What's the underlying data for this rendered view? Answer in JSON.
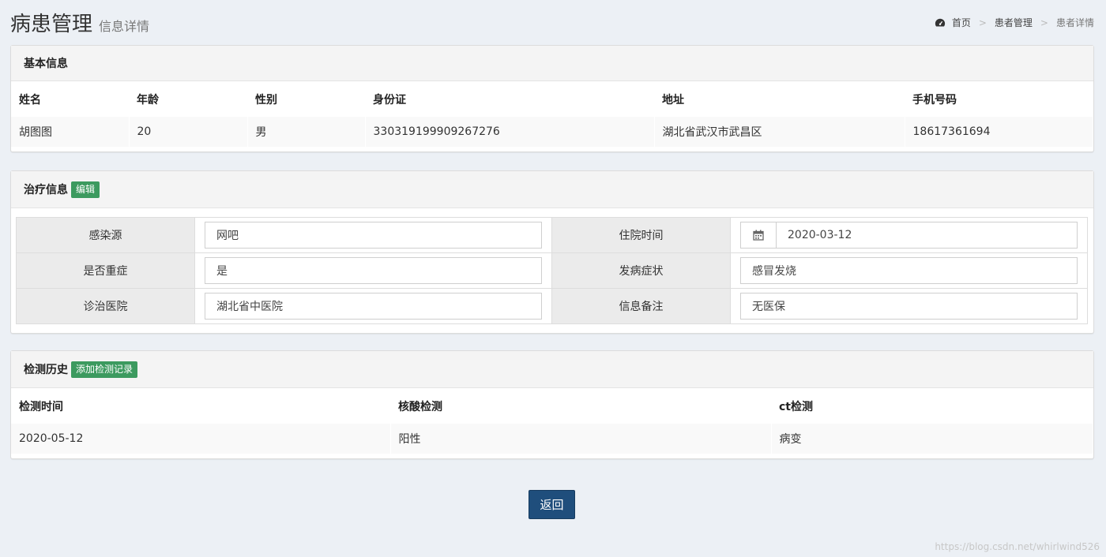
{
  "header": {
    "title": "病患管理",
    "subtitle": "信息详情",
    "breadcrumb": {
      "home": "首页",
      "section": "患者管理",
      "current": "患者详情",
      "home_icon": "dashboard-icon"
    }
  },
  "basic_info": {
    "title": "基本信息",
    "columns": [
      "姓名",
      "年龄",
      "性别",
      "身份证",
      "地址",
      "手机号码"
    ],
    "row": [
      "胡图图",
      "20",
      "男",
      "330319199909267276",
      "湖北省武汉市武昌区",
      "18617361694"
    ]
  },
  "treatment": {
    "title": "治疗信息",
    "edit_label": "编辑",
    "fields": [
      {
        "label": "感染源",
        "value": "网吧"
      },
      {
        "label": "住院时间",
        "value": "2020-03-12",
        "icon": "calendar-icon"
      },
      {
        "label": "是否重症",
        "value": "是"
      },
      {
        "label": "发病症状",
        "value": "感冒发烧"
      },
      {
        "label": "诊治医院",
        "value": "湖北省中医院"
      },
      {
        "label": "信息备注",
        "value": "无医保"
      }
    ]
  },
  "history": {
    "title": "检测历史",
    "add_label": "添加检测记录",
    "columns": [
      "检测时间",
      "核酸检测",
      "ct检测"
    ],
    "rows": [
      [
        "2020-05-12",
        "阳性",
        "病变"
      ]
    ]
  },
  "actions": {
    "back_label": "返回"
  },
  "watermark": "https://blog.csdn.net/whirlwind526",
  "colors": {
    "accent": "#3c9a5f",
    "primary": "#1f4e7c",
    "background": "#ecf0f5"
  }
}
